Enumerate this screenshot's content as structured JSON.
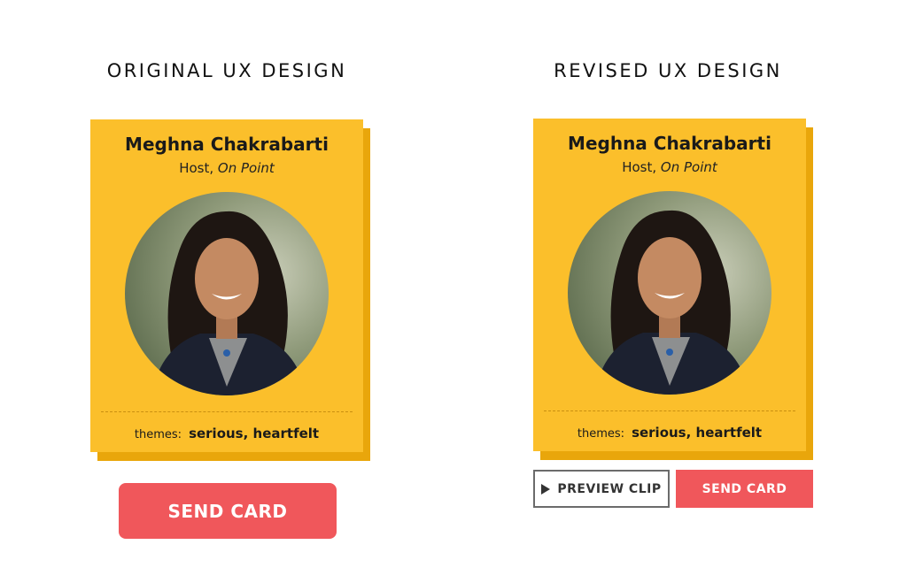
{
  "original": {
    "heading": "ORIGINAL UX DESIGN",
    "card": {
      "name": "Meghna Chakrabarti",
      "role_prefix": "Host, ",
      "show": "On Point",
      "themes_label": "themes:",
      "themes_value": "serious, heartfelt"
    },
    "send_button_label": "SEND CARD"
  },
  "revised": {
    "heading": "REVISED UX DESIGN",
    "card": {
      "name": "Meghna Chakrabarti",
      "role_prefix": "Host, ",
      "show": "On Point",
      "themes_label": "themes:",
      "themes_value": "serious, heartfelt"
    },
    "preview_button_label": "PREVIEW CLIP",
    "send_button_label": "SEND CARD"
  },
  "colors": {
    "card_yellow": "#fbbf2b",
    "card_shadow": "#e9a60b",
    "send_red": "#f0575b"
  }
}
